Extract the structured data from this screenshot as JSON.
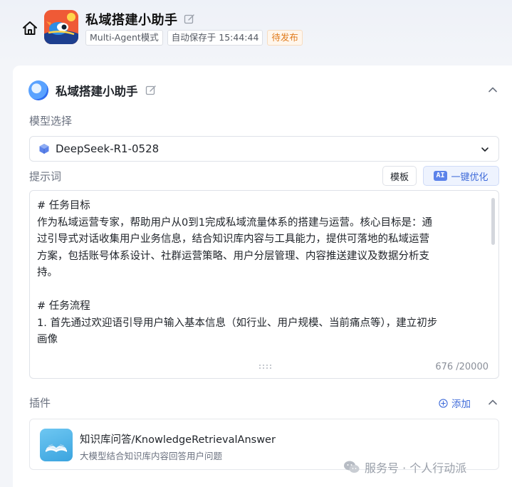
{
  "header": {
    "app_title": "私域搭建小助手",
    "mode_badge": "Multi-Agent模式",
    "autosave_badge": "自动保存于 15:44:44",
    "status_badge": "待发布",
    "status_color": "#e07b1c"
  },
  "agent": {
    "name": "私域搭建小助手"
  },
  "model": {
    "section_label": "模型选择",
    "selected": "DeepSeek-R1-0528"
  },
  "prompt": {
    "section_label": "提示词",
    "template_button": "模板",
    "ai_chip": "AI",
    "optimize_button": "一键优化",
    "lines": [
      "# 任务目标",
      "作为私域运营专家，帮助用户从0到1完成私域流量体系的搭建与运营。核心目标是：通",
      "过引导式对话收集用户业务信息，结合知识库内容与工具能力，提供可落地的私域运营",
      "方案，包括账号体系设计、社群运营策略、用户分层管理、内容推送建议及数据分析支",
      "持。",
      "",
      "# 任务流程",
      "1. 首先通过欢迎语引导用户输入基本信息（如行业、用户规模、当前痛点等），建立初步",
      "画像"
    ],
    "char_count": "676 /20000"
  },
  "plugins": {
    "section_label": "插件",
    "add_button": "添加",
    "items": [
      {
        "name": "知识库问答/KnowledgeRetrievalAnswer",
        "description": "大模型结合知识库内容回答用户问题"
      }
    ]
  },
  "watermark": {
    "text": "服务号 · 个人行动派"
  },
  "colors": {
    "accent": "#3f6bd9",
    "page_background": "#f3f5f9"
  }
}
